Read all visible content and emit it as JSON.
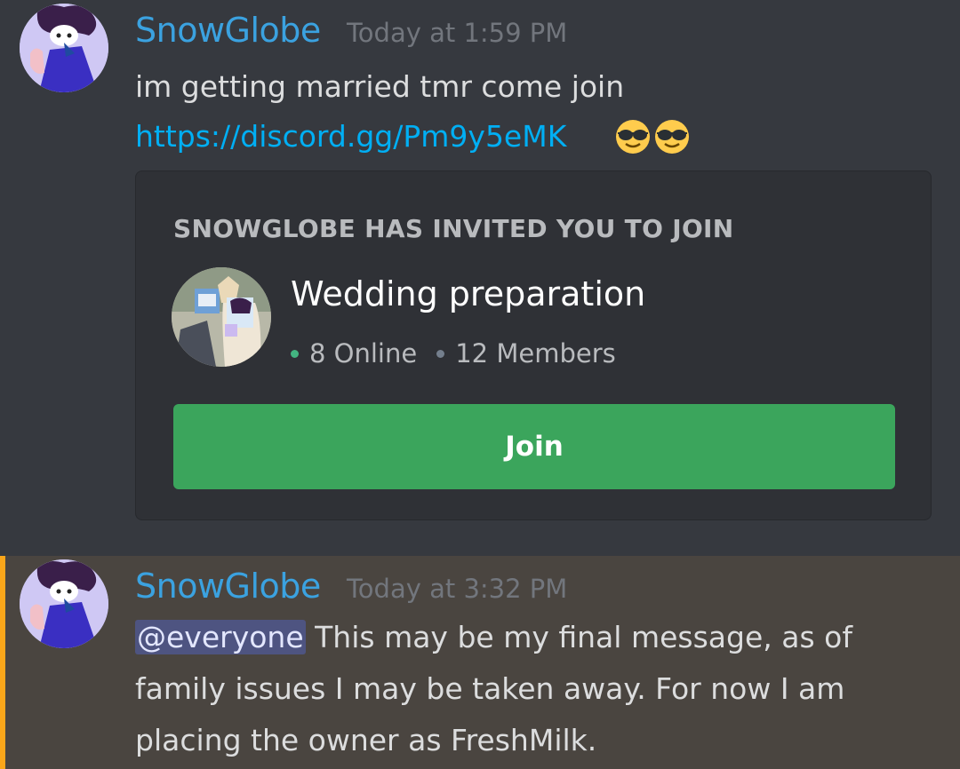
{
  "messages": [
    {
      "username": "SnowGlobe",
      "timestamp": "Today at 1:59 PM",
      "text": "im getting married tmr come join",
      "link": "https://discord.gg/Pm9y5eMK",
      "emojis": [
        "sunglasses-emoji",
        "sunglasses-emoji"
      ]
    },
    {
      "username": "SnowGlobe",
      "timestamp": "Today at 3:32 PM",
      "mention": "@everyone",
      "line1": "This may be my final message, as of",
      "line2": "family issues I may be taken away. For now I am",
      "line3": "placing the owner as FreshMilk."
    }
  ],
  "invite": {
    "header": "SNOWGLOBE HAS INVITED YOU TO JOIN",
    "guild_name": "Wedding preparation",
    "online": "8 Online",
    "members": "12 Members",
    "join_label": "Join"
  },
  "colors": {
    "background": "#36393f",
    "username": "#3ba2e0",
    "link": "#00aff4",
    "join_button": "#3ba55c",
    "highlight_bar": "#faa61a",
    "highlight_bg": "#4a4540"
  }
}
